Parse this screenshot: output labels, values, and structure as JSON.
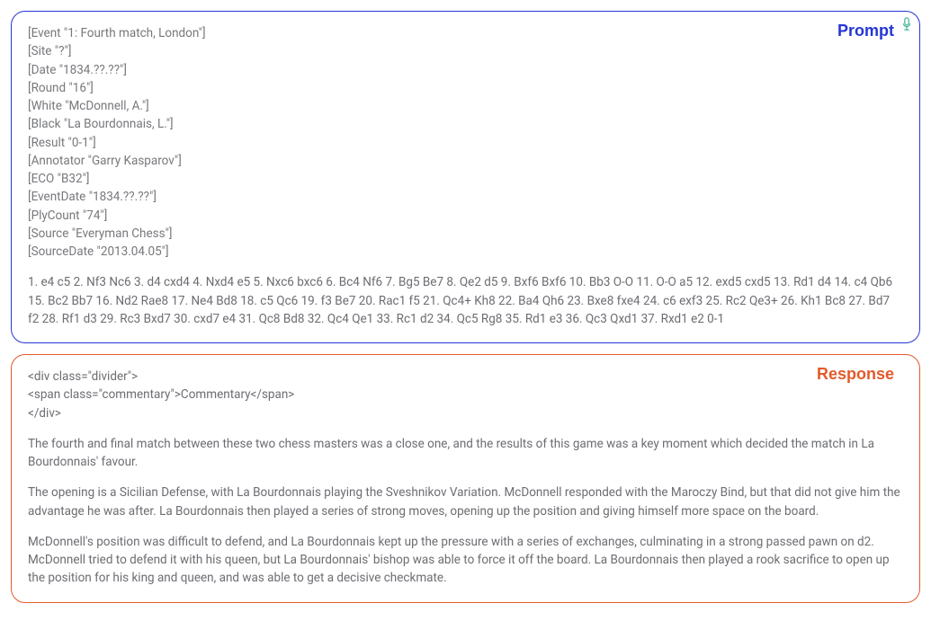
{
  "prompt": {
    "label": "Prompt",
    "pgn_tags": [
      "[Event \"1: Fourth match, London\"]",
      "[Site \"?\"]",
      "[Date \"1834.??.??\"]",
      "[Round \"16\"]",
      "[White \"McDonnell, A.\"]",
      "[Black \"La Bourdonnais, L.\"]",
      "[Result \"0-1\"]",
      "[Annotator \"Garry Kasparov\"]",
      "[ECO \"B32\"]",
      "[EventDate \"1834.??.??\"]",
      "[PlyCount \"74\"]",
      "[Source \"Everyman Chess\"]",
      "[SourceDate \"2013.04.05\"]"
    ],
    "moves": "1. e4 c5 2. Nf3 Nc6 3. d4 cxd4 4. Nxd4 e5 5. Nxc6 bxc6 6. Bc4 Nf6 7. Bg5 Be7 8. Qe2 d5 9. Bxf6 Bxf6 10. Bb3 O-O 11. O-O a5 12. exd5 cxd5 13. Rd1 d4 14. c4 Qb6 15. Bc2 Bb7 16. Nd2 Rae8 17. Ne4 Bd8 18. c5 Qc6 19. f3 Be7 20. Rac1 f5 21. Qc4+ Kh8 22. Ba4 Qh6 23. Bxe8 fxe4 24. c6 exf3 25. Rc2 Qe3+ 26. Kh1 Bc8 27. Bd7 f2 28. Rf1 d3 29. Rc3 Bxd7 30. cxd7 e4 31. Qc8 Bd8 32. Qc4 Qe1 33. Rc1 d2 34. Qc5 Rg8 35. Rd1 e3 36. Qc3 Qxd1 37. Rxd1 e2 0-1"
  },
  "response": {
    "label": "Response",
    "code_lines": [
      "<div class=\"divider\">",
      "<span class=\"commentary\">Commentary</span>",
      "</div>"
    ],
    "paragraphs": [
      "The fourth and final match between these two chess masters was a close one, and the results of this game was a key moment which decided the match in La Bourdonnais' favour.",
      "The opening is a Sicilian Defense, with La Bourdonnais playing the Sveshnikov Variation. McDonnell responded with the Maroczy Bind, but that did not give him the advantage he was after. La Bourdonnais then played a series of strong moves, opening up the position and giving himself more space on the board.",
      "McDonnell's position was difficult to defend, and La Bourdonnais kept up the pressure with a series of exchanges, culminating in a strong passed pawn on d2. McDonnell tried to defend it with his queen, but La Bourdonnais' bishop was able to force it off the board. La Bourdonnais then played a rook sacrifice to open up the position for his king and queen, and was able to get a decisive checkmate."
    ]
  }
}
